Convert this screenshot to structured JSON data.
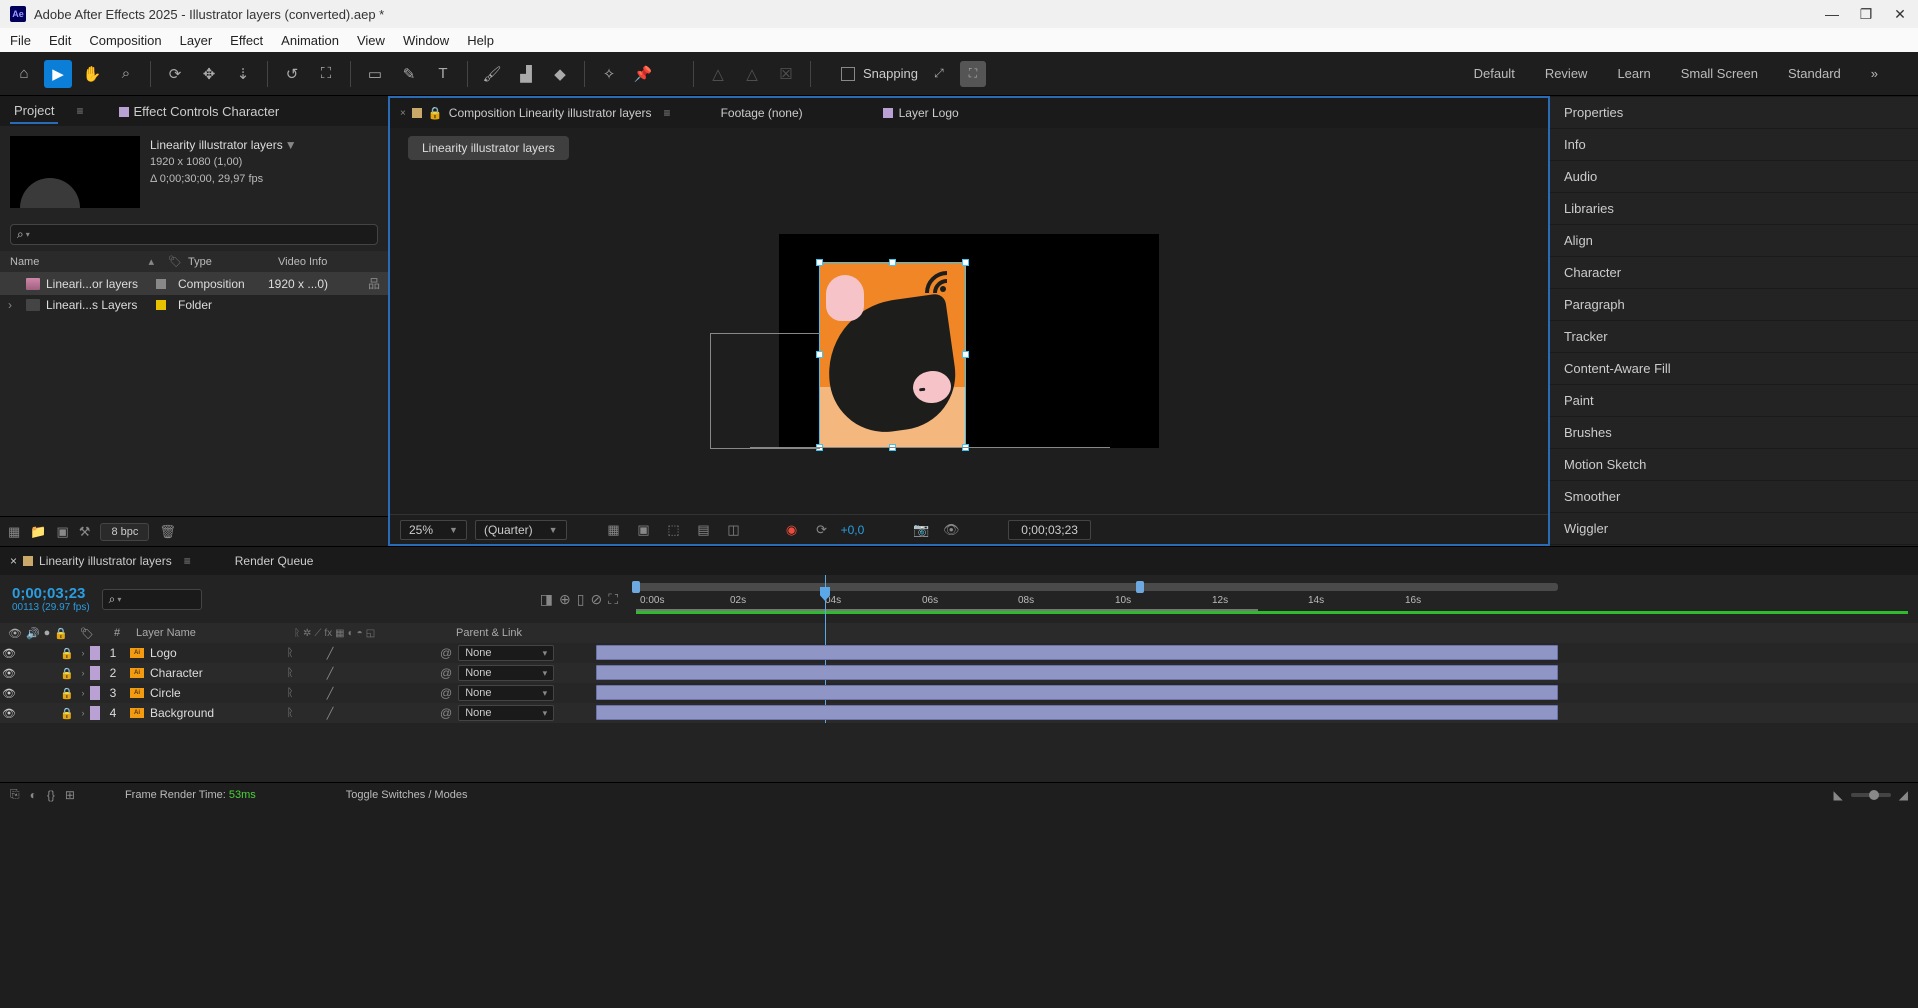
{
  "titlebar": {
    "app_icon": "Ae",
    "title": "Adobe After Effects 2025 - Illustrator layers (converted).aep *"
  },
  "menubar": [
    "File",
    "Edit",
    "Composition",
    "Layer",
    "Effect",
    "Animation",
    "View",
    "Window",
    "Help"
  ],
  "toolbar": {
    "snapping_label": "Snapping",
    "workspaces": [
      "Default",
      "Review",
      "Learn",
      "Small Screen",
      "Standard"
    ],
    "overflow": "»"
  },
  "project_panel": {
    "tab_project": "Project",
    "tab_effect": "Effect Controls Character",
    "comp_name": "Linearity illustrator layers",
    "comp_dims": "1920 x 1080 (1,00)",
    "comp_dur": "Δ 0;00;30;00, 29,97 fps",
    "search_icon": "⌕",
    "hdr_name": "Name",
    "hdr_type": "Type",
    "hdr_video": "Video Info",
    "items": [
      {
        "name": "Lineari...or layers",
        "type": "Composition",
        "video": "1920 x ...0)",
        "kind": "comp",
        "sw": "grey",
        "expand": ""
      },
      {
        "name": "Lineari...s Layers",
        "type": "Folder",
        "video": "",
        "kind": "folder",
        "sw": "yellow",
        "expand": "›"
      }
    ],
    "bpc": "8 bpc"
  },
  "viewer": {
    "tab_comp_close": "×",
    "tab_comp_label": "Composition Linearity illustrator layers",
    "tab_footage": "Footage (none)",
    "tab_layer": "Layer Logo",
    "breadcrumb": "Linearity illustrator layers",
    "zoom": "25%",
    "resolution": "(Quarter)",
    "exposure": "+0,0",
    "timecode": "0;00;03;23"
  },
  "right_panels": [
    "Properties",
    "Info",
    "Audio",
    "Libraries",
    "Align",
    "Character",
    "Paragraph",
    "Tracker",
    "Content-Aware Fill",
    "Paint",
    "Brushes",
    "Motion Sketch",
    "Smoother",
    "Wiggler"
  ],
  "timeline": {
    "tab_close": "×",
    "tab_name": "Linearity illustrator layers",
    "tab_render": "Render Queue",
    "time_main": "0;00;03;23",
    "time_sub": "00113 (29.97 fps)",
    "ruler_ticks": [
      "0:00s",
      "02s",
      "04s",
      "06s",
      "08s",
      "10s",
      "12s",
      "14s",
      "16s"
    ],
    "col_num_hdr": "#",
    "col_layername": "Layer Name",
    "col_parent": "Parent & Link",
    "layers": [
      {
        "num": "1",
        "name": "Logo",
        "parent": "None"
      },
      {
        "num": "2",
        "name": "Character",
        "parent": "None"
      },
      {
        "num": "3",
        "name": "Circle",
        "parent": "None"
      },
      {
        "num": "4",
        "name": "Background",
        "parent": "None"
      }
    ],
    "footer_render_label": "Frame Render Time:",
    "footer_render_val": "53ms",
    "footer_toggle": "Toggle Switches / Modes"
  }
}
